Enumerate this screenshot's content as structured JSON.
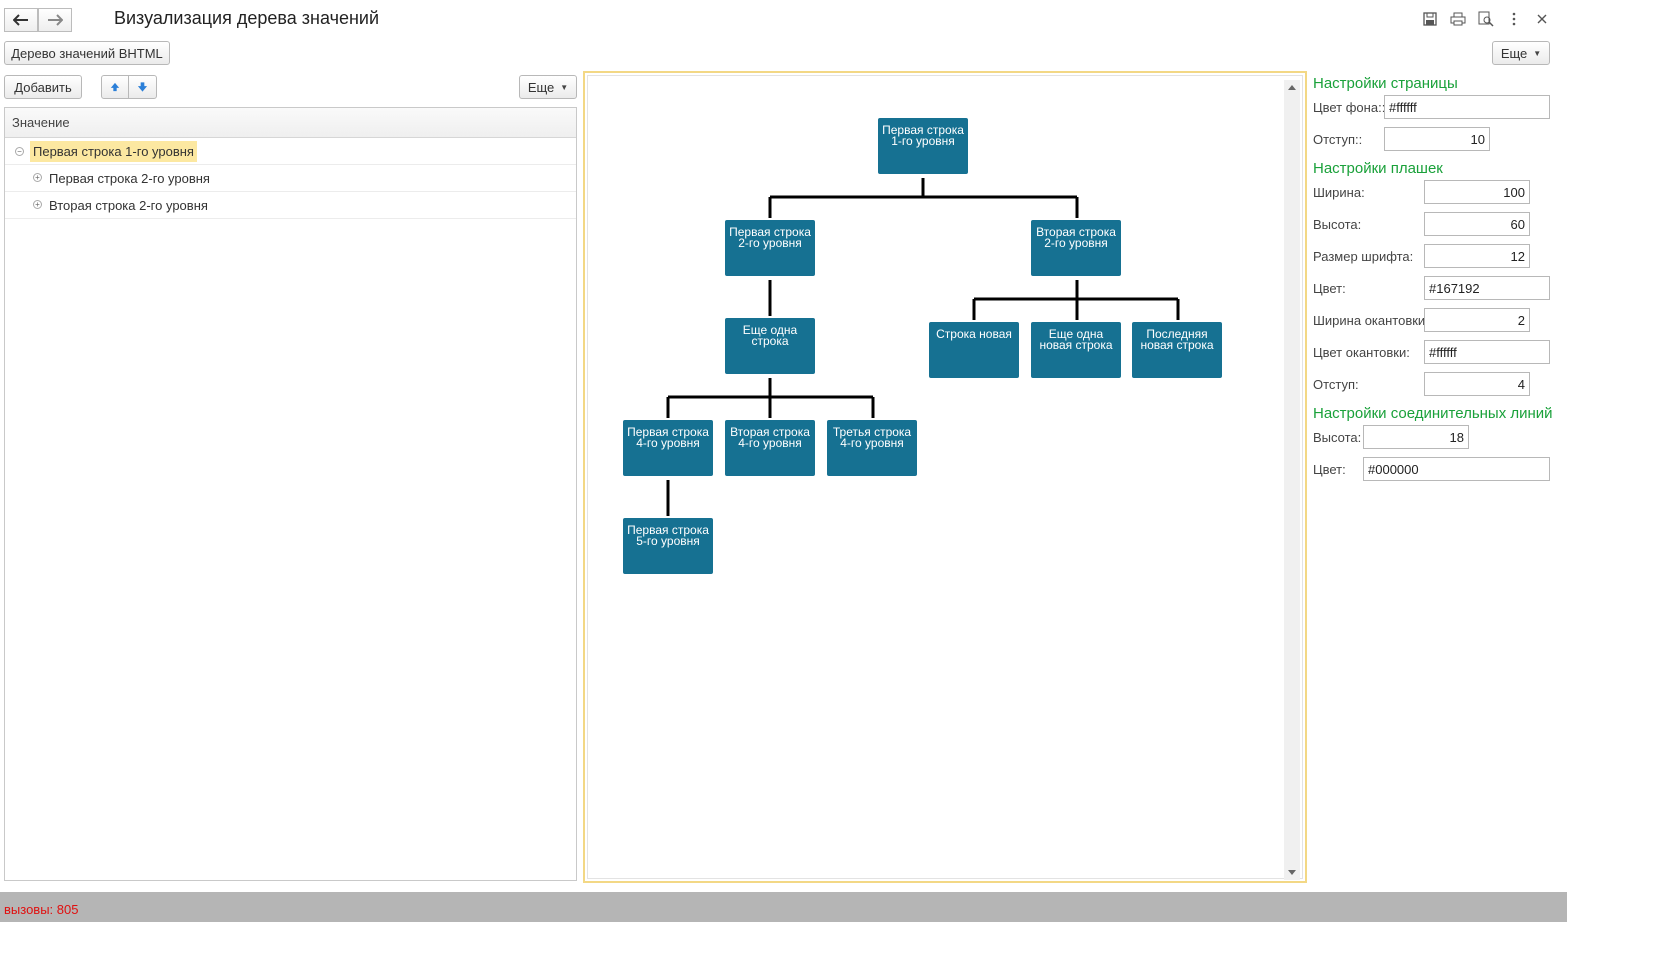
{
  "header": {
    "title": "Визуализация дерева значений"
  },
  "toolbar": {
    "main_button": "Дерево значений ВНTML",
    "more": "Еще"
  },
  "tree_toolbar": {
    "add": "Добавить",
    "more": "Еще"
  },
  "tree": {
    "column_header": "Значение",
    "rows": [
      {
        "label": "Первая строка 1-го уровня",
        "expander": "−"
      },
      {
        "label": "Первая строка 2-го уровня",
        "expander": "+"
      },
      {
        "label": "Вторая строка 2-го уровня",
        "expander": "+"
      }
    ]
  },
  "diagram": {
    "nodes": {
      "n1": "Первая строка 1-го уровня",
      "n2a": "Первая строка 2-го уровня",
      "n2b": "Вторая строка 2-го уровня",
      "n3a": "Еще одна строка",
      "n3b": "Строка новая",
      "n3c": "Еще одна новая строка",
      "n3d": "Последняя новая строка",
      "n4a": "Первая строка 4-го уровня",
      "n4b": "Вторая строка 4-го уровня",
      "n4c": "Третья строка 4-го уровня",
      "n5a": "Первая строка 5-го уровня"
    },
    "node_color": "#167192"
  },
  "settings": {
    "page": {
      "title": "Настройки страницы",
      "bg_label": "Цвет фона::",
      "bg_value": "#ffffff",
      "indent_label": "Отступ::",
      "indent_value": "10"
    },
    "plates": {
      "title": "Настройки плашек",
      "width_label": "Ширина:",
      "width_value": "100",
      "height_label": "Высота:",
      "height_value": "60",
      "font_label": "Размер шрифта:",
      "font_value": "12",
      "color_label": "Цвет:",
      "color_value": "#167192",
      "border_w_label": "Ширина окантовки:",
      "border_w_value": "2",
      "border_c_label": "Цвет окантовки:",
      "border_c_value": "#ffffff",
      "indent_label": "Отступ:",
      "indent_value": "4"
    },
    "lines": {
      "title": "Настройки соединительных линий",
      "height_label": "Высота:",
      "height_value": "18",
      "color_label": "Цвет:",
      "color_value": "#000000"
    }
  },
  "status": {
    "text": "вызовы: 805"
  }
}
